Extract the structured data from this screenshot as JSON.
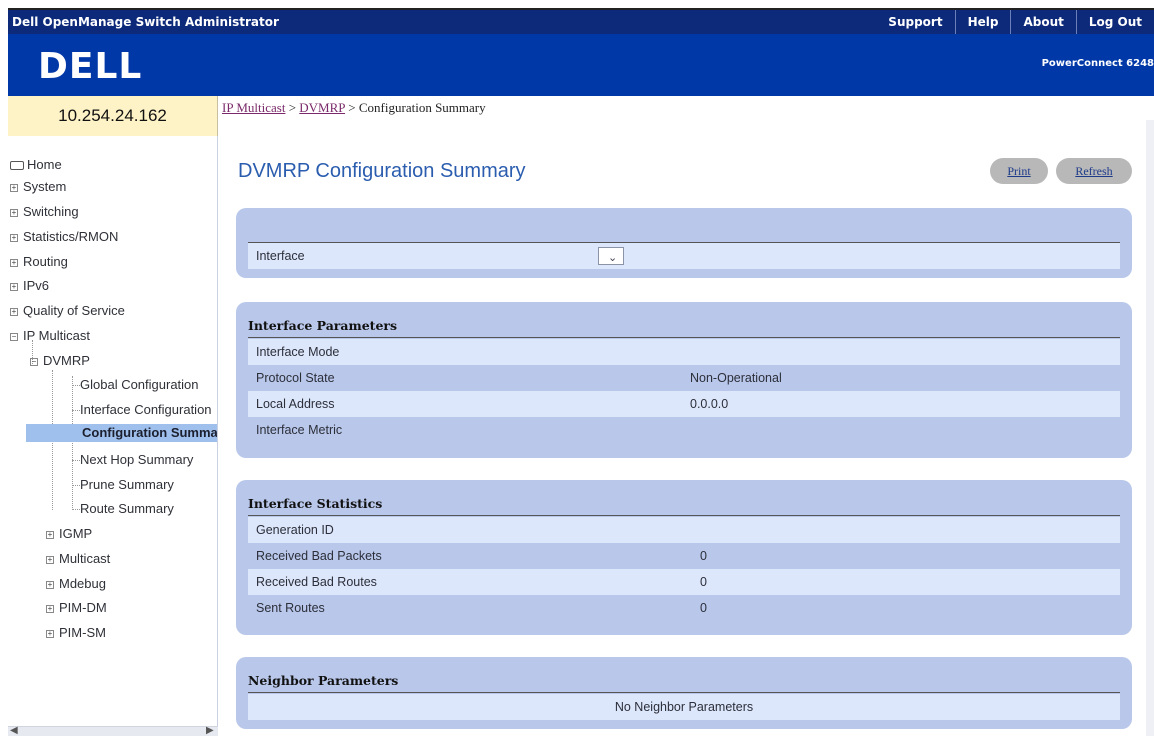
{
  "topbar": {
    "title": "Dell OpenManage Switch Administrator",
    "links": [
      "Support",
      "Help",
      "About",
      "Log Out"
    ]
  },
  "brand": {
    "logo": "DELL",
    "model": "PowerConnect 6248"
  },
  "ip_address": "10.254.24.162",
  "breadcrumb": {
    "link1": "IP Multicast",
    "sep1": " > ",
    "link2": "DVMRP",
    "sep2": " > ",
    "current": "Configuration Summary"
  },
  "sidebar": {
    "home": "Home",
    "system": "System",
    "switching": "Switching",
    "statistics": "Statistics/RMON",
    "routing": "Routing",
    "ipv6": "IPv6",
    "qos": "Quality of Service",
    "ip_multicast": "IP Multicast",
    "dvmrp": "DVMRP",
    "global_config": "Global Configuration",
    "interface_config": "Interface Configuration",
    "config_summary": "Configuration Summary",
    "next_hop": "Next Hop Summary",
    "prune": "Prune Summary",
    "route": "Route Summary",
    "igmp": "IGMP",
    "multicast": "Multicast",
    "mdebug": "Mdebug",
    "pim_dm": "PIM-DM",
    "pim_sm": "PIM-SM"
  },
  "page": {
    "title": "DVMRP Configuration Summary",
    "print": "Print",
    "refresh": "Refresh"
  },
  "interface_select": {
    "label": "Interface",
    "value": ""
  },
  "interface_parameters": {
    "heading": "Interface Parameters",
    "rows": [
      {
        "label": "Interface Mode",
        "value": ""
      },
      {
        "label": "Protocol State",
        "value": "Non-Operational"
      },
      {
        "label": "Local Address",
        "value": "0.0.0.0"
      },
      {
        "label": "Interface Metric",
        "value": ""
      }
    ]
  },
  "interface_statistics": {
    "heading": "Interface Statistics",
    "rows": [
      {
        "label": "Generation ID",
        "value": ""
      },
      {
        "label": "Received Bad Packets",
        "value": "0"
      },
      {
        "label": "Received Bad Routes",
        "value": "0"
      },
      {
        "label": "Sent Routes",
        "value": "0"
      }
    ]
  },
  "neighbor_parameters": {
    "heading": "Neighbor Parameters",
    "empty_text": "No Neighbor Parameters"
  }
}
